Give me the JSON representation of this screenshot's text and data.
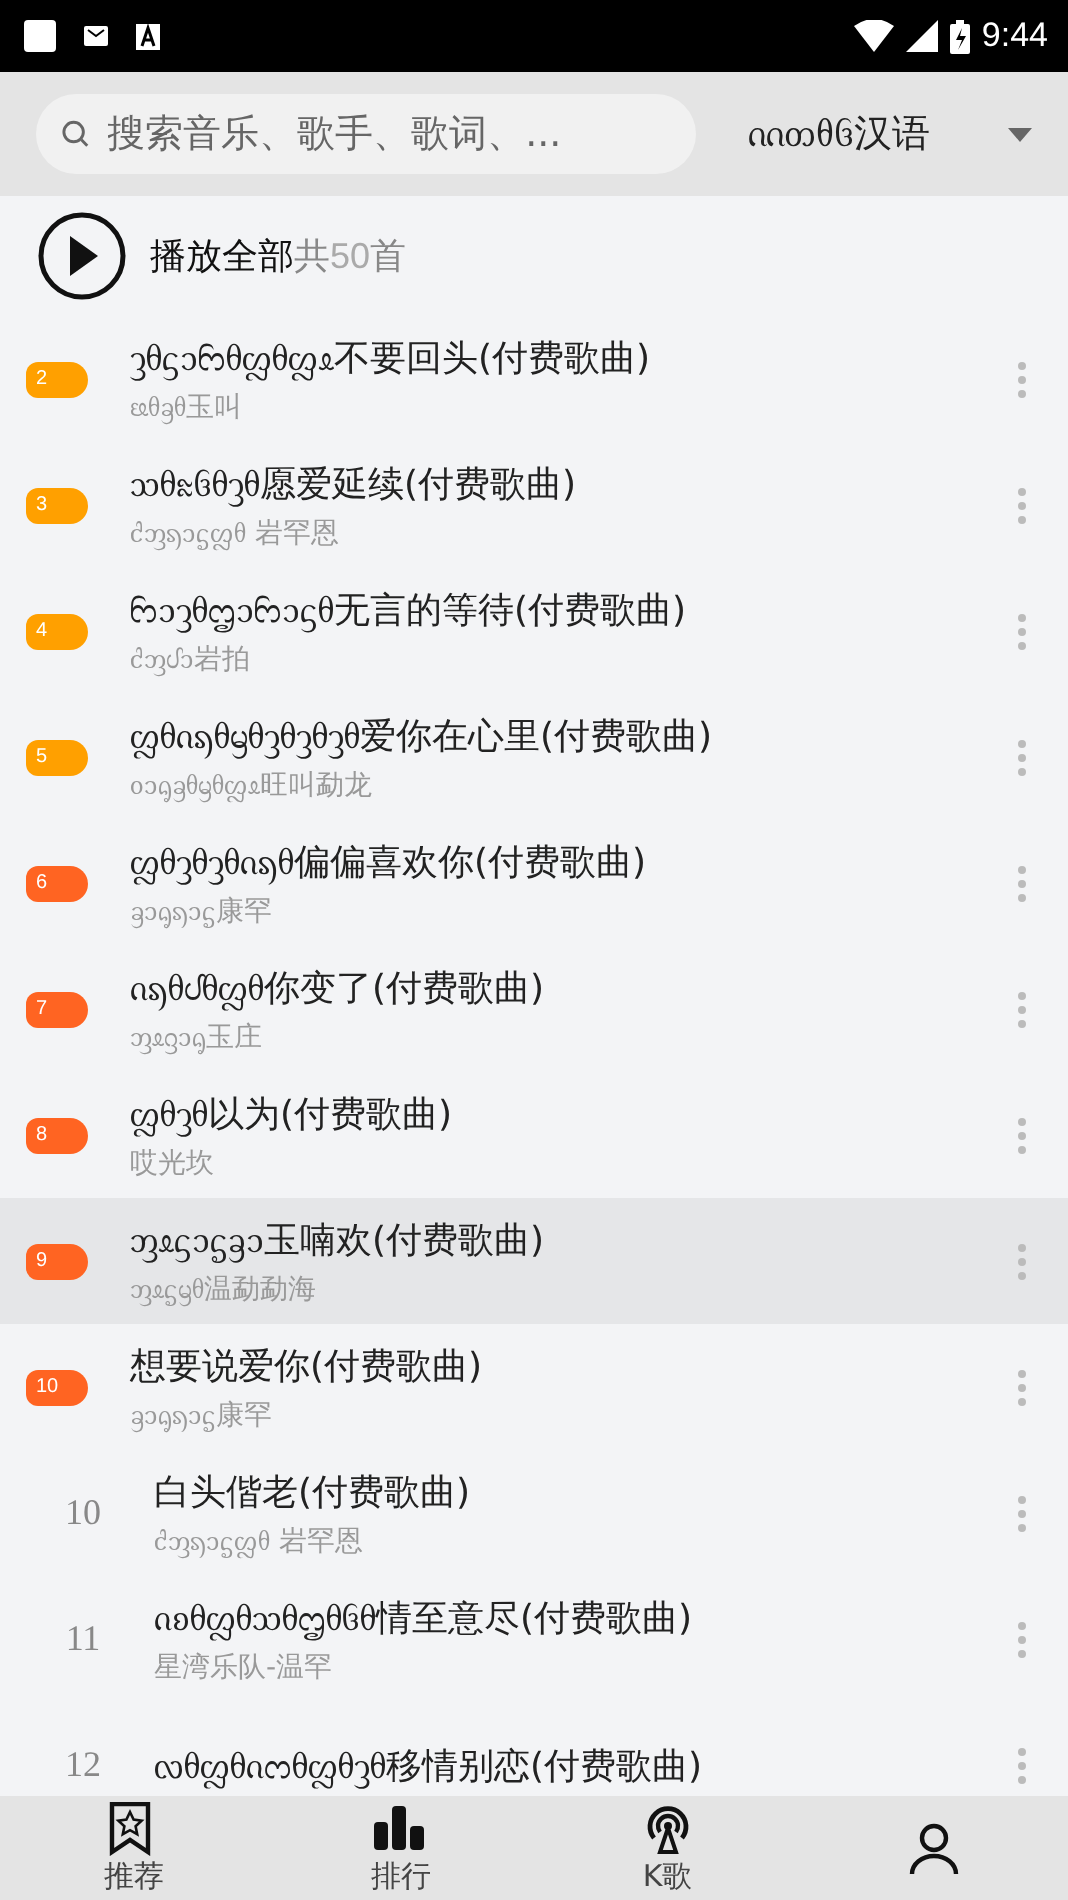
{
  "status_bar": {
    "time": "9:44"
  },
  "search": {
    "placeholder": "搜索音乐、歌手、歌词、..."
  },
  "language": {
    "label": "ᦶᦎᦲᦑ汉语"
  },
  "play_all": {
    "label": "播放全部",
    "count_prefix": "共",
    "count": "50",
    "count_suffix": "首"
  },
  "songs": [
    {
      "kind": "badge",
      "rank": "2",
      "color": "#ffa000",
      "title": "ᦡᦲᦓᦱᦝᦲᦜᦲᦜᦸ不要回头(付费歌曲)",
      "artist": "ᦕᦲᦃᦲ玉叫",
      "selected": false
    },
    {
      "kind": "badge",
      "rank": "3",
      "color": "#ffa000",
      "title": "ᦉᦲᦰᦑᦲᦡᦲ愿爱延续(付费歌曲)",
      "artist": "ᦺᦀᦣᦱᧃᦜᦲ 岩罕恩",
      "selected": false
    },
    {
      "kind": "badge",
      "rank": "4",
      "color": "#ffa000",
      "title": "ᦝᦱᦡᦲᦗᦱᦝᦱᦓᦲ无言的等待(付费歌曲)",
      "artist": "ᦺᦀᦔᦱ岩拍",
      "selected": false
    },
    {
      "kind": "badge",
      "rank": "5",
      "color": "#ffa000",
      "title": "ᦜᦲᦵᦣᦲᦙᦲᦡᦲᦡᦲᦡᦲ爱你在心里(付费歌曲)",
      "artist": "ᦞᦱᧂᦃᦲᦙᦲᦜᦸ旺叫勐龙",
      "selected": false
    },
    {
      "kind": "badge",
      "rank": "6",
      "color": "#ff6422",
      "title": "ᦜᦲᦡᦲᦡᦲᦵᦣᦲ偏偏喜欢你(付费歌曲)",
      "artist": "ᦃᦱᧂᦣᦱᧃ康罕",
      "selected": false
    },
    {
      "kind": "badge",
      "rank": "7",
      "color": "#ff6422",
      "title": "ᦵᦣᦲᦔᦲᦜᦲ你变了(付费歌曲)",
      "artist": "ᦀᦸᦋᦱᧂ玉庄",
      "selected": false
    },
    {
      "kind": "badge",
      "rank": "8",
      "color": "#ff6422",
      "title": "ᦜᦲᦡᦲ以为(付费歌曲)",
      "artist": "哎光坎",
      "selected": false
    },
    {
      "kind": "badge",
      "rank": "9",
      "color": "#ff6422",
      "title": "ᦀᦸᦓᦱᧃᦃᦱ玉喃欢(付费歌曲)",
      "artist": "ᦀᦸᧃᦙᦲ温勐勐海",
      "selected": true
    },
    {
      "kind": "badge",
      "rank": "10",
      "color": "#ff6422",
      "title": "想要说爱你(付费歌曲)",
      "artist": "ᦃᦱᧂᦣᦱᧃ康罕",
      "selected": false
    },
    {
      "kind": "plain",
      "rank": "10",
      "title": "白头偕老(付费歌曲)",
      "artist": "ᦺᦀᦣᦱᧃᦜᦲ 岩罕恩",
      "selected": false
    },
    {
      "kind": "plain",
      "rank": "11",
      "title": "ᦵᦈᦲᦜᦲᦉᦲᦗᦲᦑᦲ情至意尽(付费歌曲)",
      "artist": "星湾乐队-温罕",
      "selected": false
    },
    {
      "kind": "plain",
      "rank": "12",
      "title": "ᦟᦲᦜᦲᦵᦂᦲᦜᦲᦡᦲ移情别恋(付费歌曲)",
      "selected": false
    }
  ],
  "nav": [
    {
      "label": "推荐"
    },
    {
      "label": "排行"
    },
    {
      "label": "K歌"
    }
  ]
}
